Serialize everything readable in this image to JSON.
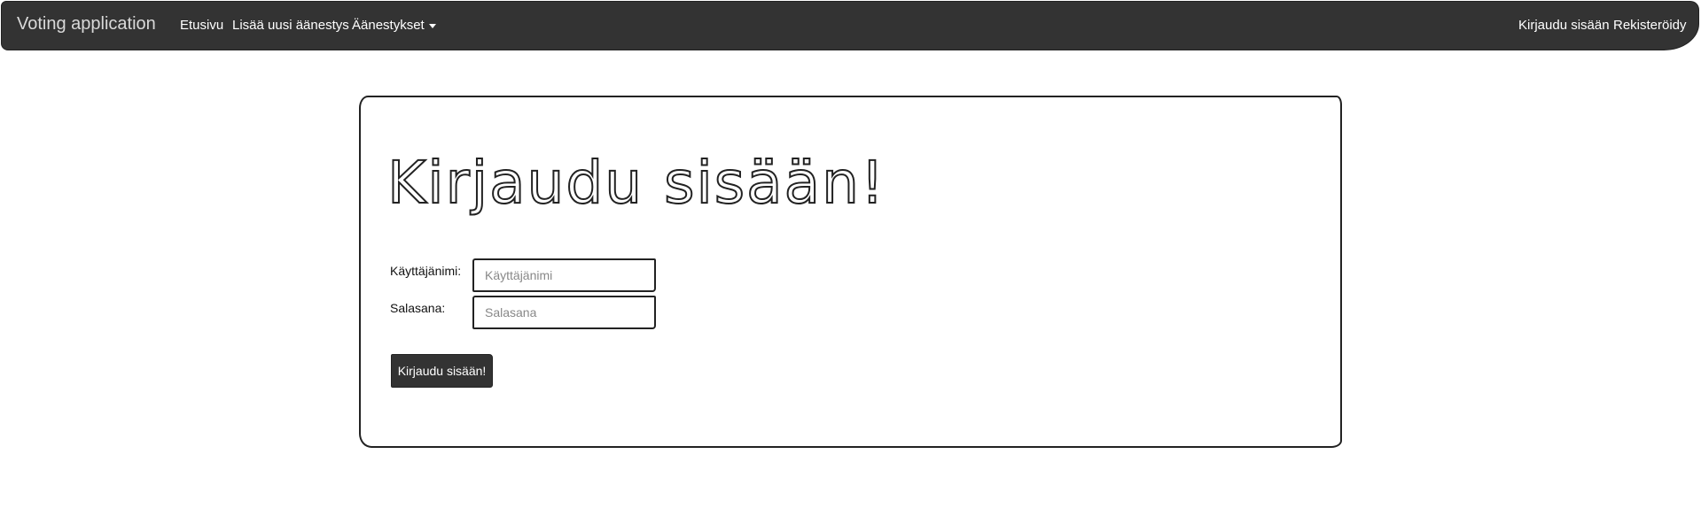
{
  "navbar": {
    "brand": "Voting application",
    "left_links": [
      "Etusivu",
      "Lisää uusi äänestys",
      "Äänestykset"
    ],
    "right_links": [
      "Kirjaudu sisään",
      "Rekisteröidy"
    ]
  },
  "main": {
    "title": "Kirjaudu sisään!",
    "username_label": "Käyttäjänimi:",
    "username_placeholder": "Käyttäjänimi",
    "username_value": "",
    "password_label": "Salasana:",
    "password_placeholder": "Salasana",
    "password_value": "",
    "submit_label": "Kirjaudu sisään!"
  },
  "colors": {
    "navbar_bg": "#333333",
    "button_bg": "#333333",
    "border": "#222222"
  }
}
